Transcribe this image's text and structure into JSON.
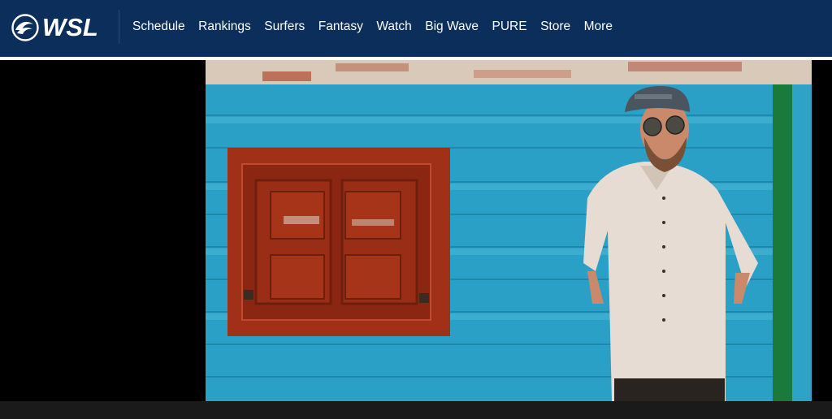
{
  "header": {
    "logo_text": "WSL",
    "nav_items": [
      "Schedule",
      "Rankings",
      "Surfers",
      "Fantasy",
      "Watch",
      "Big Wave",
      "PURE",
      "Store",
      "More"
    ]
  },
  "hero": {
    "subject": "man-with-cap-and-sunglasses-by-blue-wall-photo"
  },
  "colors": {
    "nav_bg": "#0b2e5a",
    "wall_blue": "#2aa3c9",
    "window_red": "#a03018",
    "post_green": "#1a7a3c"
  }
}
